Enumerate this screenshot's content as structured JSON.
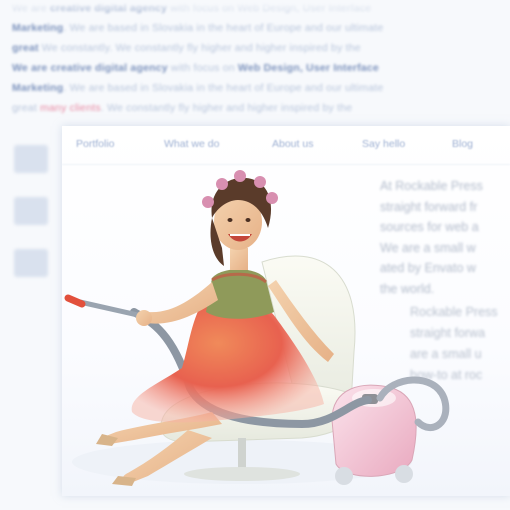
{
  "background_text": {
    "lines": [
      [
        {
          "t": "We are ",
          "b": false
        },
        {
          "t": "creative digital agency",
          "b": true
        },
        {
          "t": " with focus on Web Design, User Interface",
          "b": false
        }
      ],
      [
        {
          "t": "Marketing",
          "b": true
        },
        {
          "t": ". We are based in Slovakia in the heart of Europe and our ultimate",
          "b": false
        }
      ],
      [
        {
          "t": "great",
          "b": true
        },
        {
          "t": " We constantly. We constantly fly higher and higher inspired by the",
          "b": false
        }
      ],
      [
        {
          "t": "We are ",
          "b": true
        },
        {
          "t": "creative digital agency",
          "b": true
        },
        {
          "t": " with focus on ",
          "b": false
        },
        {
          "t": "Web Design, User Interface",
          "b": true
        }
      ],
      [
        {
          "t": "Marketing",
          "b": true
        },
        {
          "t": ". We are based in Slovakia in the heart of Europe and our ultimate",
          "b": false
        }
      ],
      [
        {
          "t": "great ",
          "b": false
        },
        {
          "t": "many clients",
          "p": true
        },
        {
          "t": ". We constantly fly higher and higher inspired by the",
          "b": false
        }
      ]
    ]
  },
  "nav": {
    "items": [
      "Portfolio",
      "What we do",
      "About us",
      "Say hello",
      "Blog"
    ]
  },
  "content": {
    "paragraph1": [
      "At Rockable Press",
      "straight forward fr",
      "sources for web a",
      "We are a small w",
      "ated by Envato w",
      "the world."
    ],
    "paragraph2": [
      "Rockable Press",
      "straight forwa",
      "are a small u",
      "how-to at roc"
    ]
  },
  "colors": {
    "accent": "#7d93bd",
    "highlight_pink": "#e88aa3",
    "vacuum_pink": "#f3c9d6",
    "dress_red": "#e8614f"
  },
  "illustration": {
    "icon": "woman-with-vacuum-illustration"
  }
}
